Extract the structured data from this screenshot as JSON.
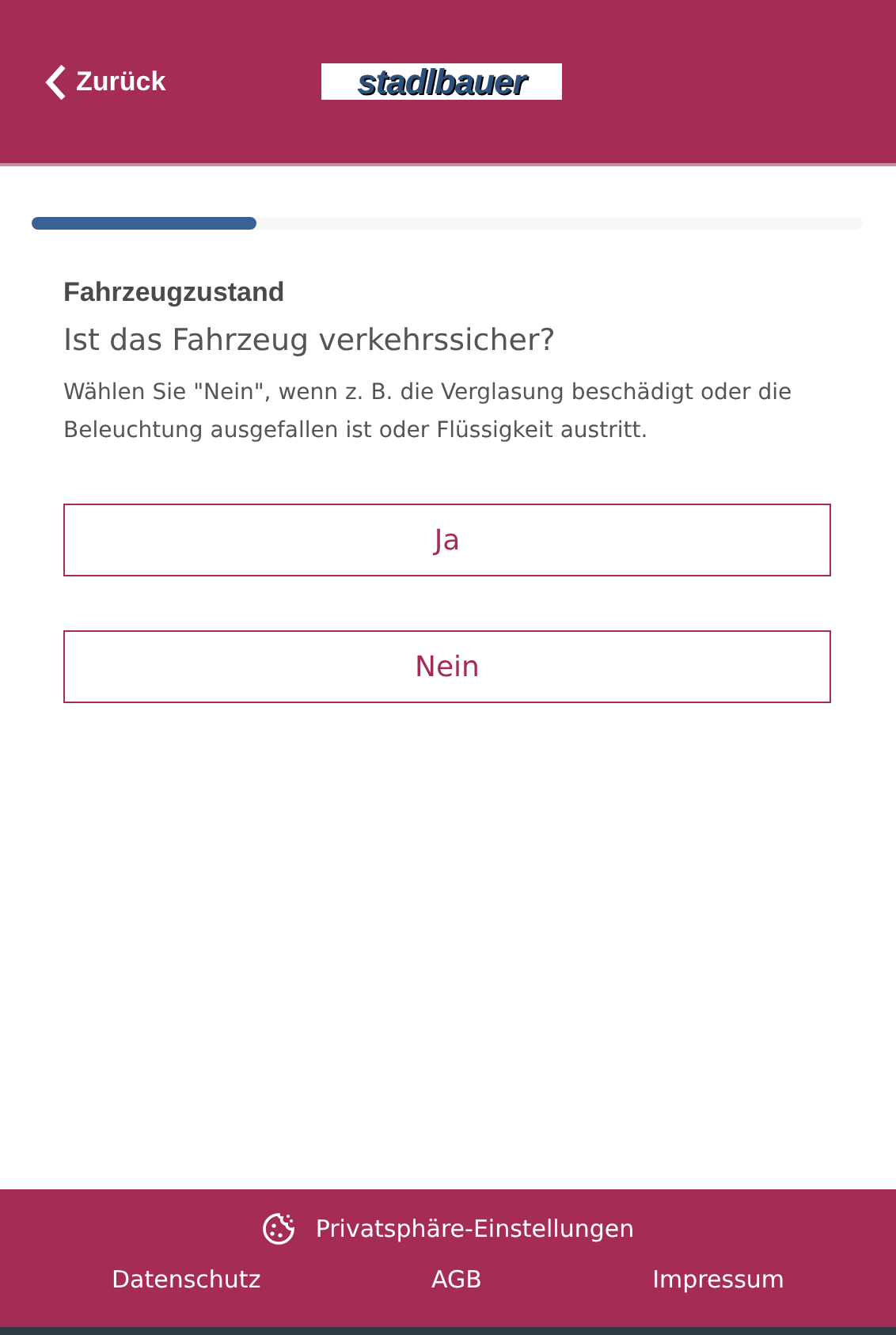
{
  "header": {
    "back_label": "Zurück",
    "logo": "stadlbauer"
  },
  "progress": {
    "level": 0.27
  },
  "question": {
    "section": "Fahrzeugzustand",
    "title": "Ist das Fahrzeug verkehrssicher?",
    "hint": "Wählen Sie \"Nein\", wenn z. B. die Verglasung beschädigt oder die Beleuchtung ausgefallen ist oder Flüssigkeit austritt."
  },
  "answers": [
    "Ja",
    "Nein"
  ],
  "footer": {
    "privacy_settings": "Privatsphäre-Einstellungen",
    "links": [
      "Datenschutz",
      "AGB",
      "Impressum"
    ]
  }
}
